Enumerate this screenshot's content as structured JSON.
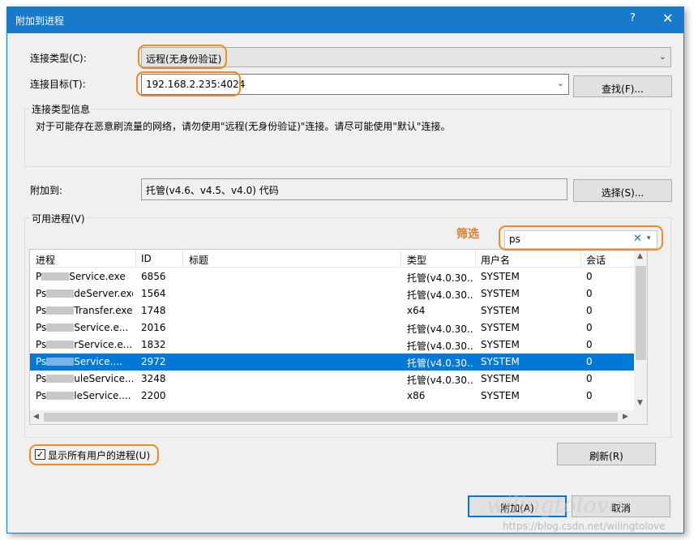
{
  "window": {
    "title": "附加到进程",
    "help_glyph": "?",
    "close_glyph": "✕"
  },
  "connection_type": {
    "label": "连接类型(C):",
    "value": "远程(无身份验证)"
  },
  "connection_target": {
    "label": "连接目标(T):",
    "value": "192.168.2.235:4024",
    "find_button": "查找(F)..."
  },
  "info": {
    "title": "连接类型信息",
    "text": "对于可能存在恶意刷流量的网络，请勿使用\"远程(无身份验证)\"连接。请尽可能使用\"默认\"连接。"
  },
  "attach_to": {
    "label": "附加到:",
    "value": "托管(v4.6、v4.5、v4.0) 代码",
    "select_button": "选择(S)..."
  },
  "available_processes": {
    "title": "可用进程(V)",
    "filter_label": "筛选",
    "filter_value": "ps",
    "columns": [
      "进程",
      "ID",
      "标题",
      "类型",
      "用户名",
      "会话"
    ],
    "rows": [
      {
        "process_prefix": "P",
        "process_suffix": "Service.exe",
        "id": "6856",
        "title": "",
        "type": "托管(v4.0.30...",
        "user": "SYSTEM",
        "session": "0",
        "selected": false
      },
      {
        "process_prefix": "Ps",
        "process_suffix": "deServer.exe",
        "id": "1564",
        "title": "",
        "type": "托管(v4.0.30...",
        "user": "SYSTEM",
        "session": "0",
        "selected": false
      },
      {
        "process_prefix": "Ps",
        "process_suffix": "Transfer.exe",
        "id": "1748",
        "title": "",
        "type": "x64",
        "user": "SYSTEM",
        "session": "0",
        "selected": false
      },
      {
        "process_prefix": "Ps",
        "process_suffix": "Service.e...",
        "id": "2016",
        "title": "",
        "type": "托管(v4.0.30...",
        "user": "SYSTEM",
        "session": "0",
        "selected": false
      },
      {
        "process_prefix": "Ps",
        "process_suffix": "rService.e...",
        "id": "1832",
        "title": "",
        "type": "托管(v4.0.30...",
        "user": "SYSTEM",
        "session": "0",
        "selected": false
      },
      {
        "process_prefix": "Ps",
        "process_suffix": "Service....",
        "id": "2972",
        "title": "",
        "type": "托管(v4.0.30...",
        "user": "SYSTEM",
        "session": "0",
        "selected": true
      },
      {
        "process_prefix": "Ps",
        "process_suffix": "uleService....",
        "id": "3248",
        "title": "",
        "type": "托管(v4.0.30...",
        "user": "SYSTEM",
        "session": "0",
        "selected": false
      },
      {
        "process_prefix": "Ps",
        "process_suffix": "leService....",
        "id": "2200",
        "title": "",
        "type": "x86",
        "user": "SYSTEM",
        "session": "0",
        "selected": false
      }
    ]
  },
  "show_all_users": {
    "label": "显示所有用户的进程(U)",
    "checked": true
  },
  "refresh_button": "刷新(R)",
  "attach_button": "附加(A)",
  "cancel_button": "取消",
  "watermark": {
    "main": "wilingtolove",
    "url": "https://blog.csdn.net/wilingtolove"
  },
  "colors": {
    "accent": "#1979ca",
    "selection": "#0078d7",
    "highlight": "#f08a24"
  }
}
